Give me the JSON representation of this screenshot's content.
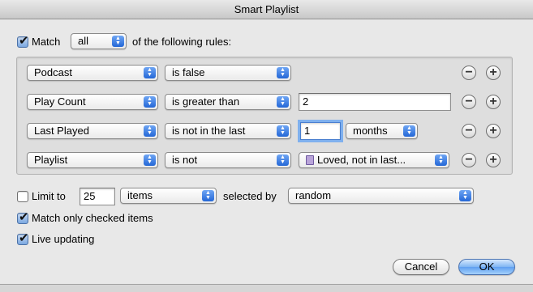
{
  "window": {
    "title": "Smart Playlist"
  },
  "match": {
    "checked": true,
    "label": "Match",
    "mode": "all",
    "suffix": "of the following rules:"
  },
  "rules": [
    {
      "field": "Podcast",
      "operator": "is false"
    },
    {
      "field": "Play Count",
      "operator": "is greater than",
      "value": "2"
    },
    {
      "field": "Last Played",
      "operator": "is not in the last",
      "value": "1",
      "unit": "months"
    },
    {
      "field": "Playlist",
      "operator": "is not",
      "value": "Loved, not in last..."
    }
  ],
  "remove_glyph": "−",
  "add_glyph": "+",
  "limit": {
    "checked": false,
    "label": "Limit to",
    "value": "25",
    "unit": "items",
    "selected_by_label": "selected by",
    "selected_by": "random"
  },
  "match_checked": {
    "checked": true,
    "label": "Match only checked items"
  },
  "live_updating": {
    "checked": true,
    "label": "Live updating"
  },
  "buttons": {
    "cancel": "Cancel",
    "ok": "OK"
  },
  "icons": {
    "checkmark": "✔",
    "popup_arrows": "updown-arrows-icon",
    "playlist": "playlist-icon"
  },
  "colors": {
    "accent": "#2467d6",
    "default_button": "#7fb3f2"
  }
}
